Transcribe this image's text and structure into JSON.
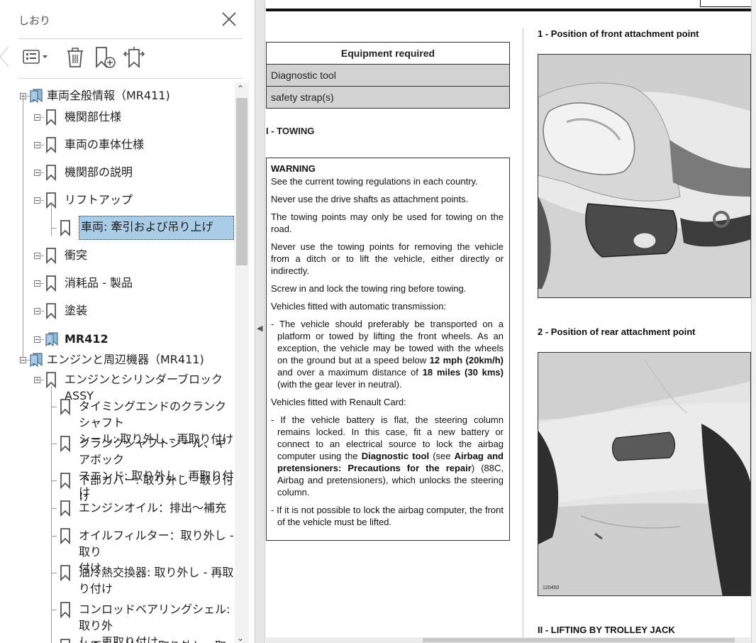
{
  "sidebar": {
    "title": "しおり",
    "tree": [
      {
        "label": "車両全般情報（MR411)",
        "level": 0
      },
      {
        "label": "機関部仕様",
        "level": 1
      },
      {
        "label": "車両の車体仕様",
        "level": 1
      },
      {
        "label": "機関部の説明",
        "level": 1
      },
      {
        "label": "リフトアップ",
        "level": 1
      },
      {
        "label": "車両: 牽引および吊り上げ",
        "level": 2,
        "selected": true
      },
      {
        "label": "衝突",
        "level": 1
      },
      {
        "label": "消耗品 - 製品",
        "level": 1
      },
      {
        "label": "塗装",
        "level": 1
      },
      {
        "label": "MR412",
        "level": 1,
        "bold": true
      },
      {
        "label": "エンジンと周辺機器（MR411)",
        "level": 0
      },
      {
        "label": "エンジンとシリンダーブロックASSY",
        "level": 1
      },
      {
        "label": "タイミングエンドのクランクシャフト",
        "label2": "シール: 取り外し - 再取り付け",
        "level": 2
      },
      {
        "label": "クランクシャフトシール、ギアボック",
        "label2": "スエンド: 取り外し - 再取り付け",
        "level": 2
      },
      {
        "label": "下部カバー: 取り外し - 取り付け",
        "level": 2
      },
      {
        "label": "エンジンオイル：排出～補充",
        "level": 2
      },
      {
        "label": "オイルフィルター：取り外し - 取り",
        "label2": "付け",
        "level": 2
      },
      {
        "label": "油冷熱交換器: 取り外し - 再取",
        "label2": "り付け",
        "level": 2
      },
      {
        "label": "コンロッドベアリングシェル: 取り外",
        "label2": "し - 再取り付け",
        "level": 2
      },
      {
        "label": "油圧センサー：取り外し - 取り",
        "level": 2
      }
    ]
  },
  "doc": {
    "equipment": {
      "header": "Equipment required",
      "items": [
        "Diagnostic tool",
        "safety strap(s)"
      ]
    },
    "towing_heading": "I - TOWING",
    "warning": {
      "title": "WARNING",
      "p1": "See the current towing regulations in each country.",
      "p2": "Never use the drive shafts as attachment points.",
      "p3": "The towing points may only be used for towing on the road.",
      "p4": "Never use the towing points for removing the vehicle from a ditch or to lift the vehicle, either directly or indirectly.",
      "p5": "Screw in and lock the towing ring before towing.",
      "p6": "Vehicles fitted with automatic transmission:",
      "p7a": "- The vehicle should preferably be transported on a platform or towed by lifting the front wheels. As an exception, the vehicle may be towed with the wheels on the ground but at a speed below ",
      "p7b": "12 mph (20km/h)",
      "p7c": " and over a maximum distance of ",
      "p7d": "18 miles (30 kms)",
      "p7e": " (with the gear lever in neutral).",
      "p8": "Vehicles fitted with Renault Card:",
      "p9a": "- If the vehicle battery is flat, the steering column remains locked. In this case, fit a new battery or connect to an electrical source to lock the airbag computer using the ",
      "p9b": "Diagnostic tool",
      "p9c": "  (see ",
      "p9d": "Airbag and pretensioners: Precautions for the repair",
      "p9e": ") (88C, Airbag and pretensioners), which unlocks the steering column.",
      "p10": "- If it is not possible to lock the airbag computer, the front of the vehicle must be lifted."
    },
    "fig1_caption": "1 - Position of front attachment point",
    "fig2_caption": "2 - Position of rear attachment point",
    "fig2_ref": "120450",
    "lifting_heading": "II - LIFTING BY TROLLEY JACK"
  }
}
